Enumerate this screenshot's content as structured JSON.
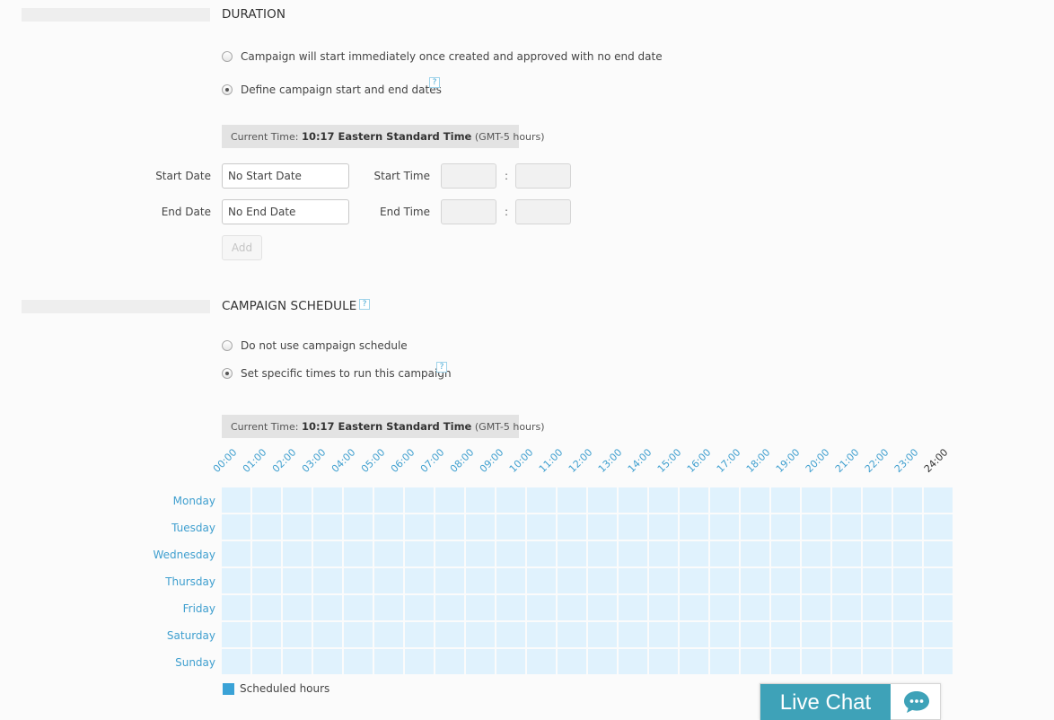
{
  "duration": {
    "title": "DURATION",
    "option_immediate": "Campaign will start immediately once created and approved with no end date",
    "option_define": "Define campaign start and end dates",
    "help_glyph": "?",
    "current_time_label": "Current Time:",
    "current_time_value": "10:17 Eastern Standard Time",
    "current_time_offset": "(GMT-5 hours)",
    "start_date_label": "Start Date",
    "start_date_value": "No Start Date",
    "end_date_label": "End Date",
    "end_date_value": "No End Date",
    "start_time_label": "Start Time",
    "end_time_label": "End Time",
    "colon": ":",
    "add_label": "Add"
  },
  "schedule": {
    "title": "CAMPAIGN SCHEDULE",
    "help_glyph": "?",
    "option_none": "Do not use campaign schedule",
    "option_specific": "Set specific times to run this campaign",
    "current_time_label": "Current Time:",
    "current_time_value": "10:17 Eastern Standard Time",
    "current_time_offset": "(GMT-5 hours)",
    "hours": [
      "00:00",
      "01:00",
      "02:00",
      "03:00",
      "04:00",
      "05:00",
      "06:00",
      "07:00",
      "08:00",
      "09:00",
      "10:00",
      "11:00",
      "12:00",
      "13:00",
      "14:00",
      "15:00",
      "16:00",
      "17:00",
      "18:00",
      "19:00",
      "20:00",
      "21:00",
      "22:00",
      "23:00",
      "24:00"
    ],
    "days": [
      "Monday",
      "Tuesday",
      "Wednesday",
      "Thursday",
      "Friday",
      "Saturday",
      "Sunday"
    ],
    "legend_label": "Scheduled hours",
    "legend_color": "#3aa2d6",
    "cell_color": "#e0f2fd"
  },
  "chat": {
    "label": "Live Chat",
    "icon": "chat-bubble-icon",
    "color": "#3ea2b8"
  }
}
